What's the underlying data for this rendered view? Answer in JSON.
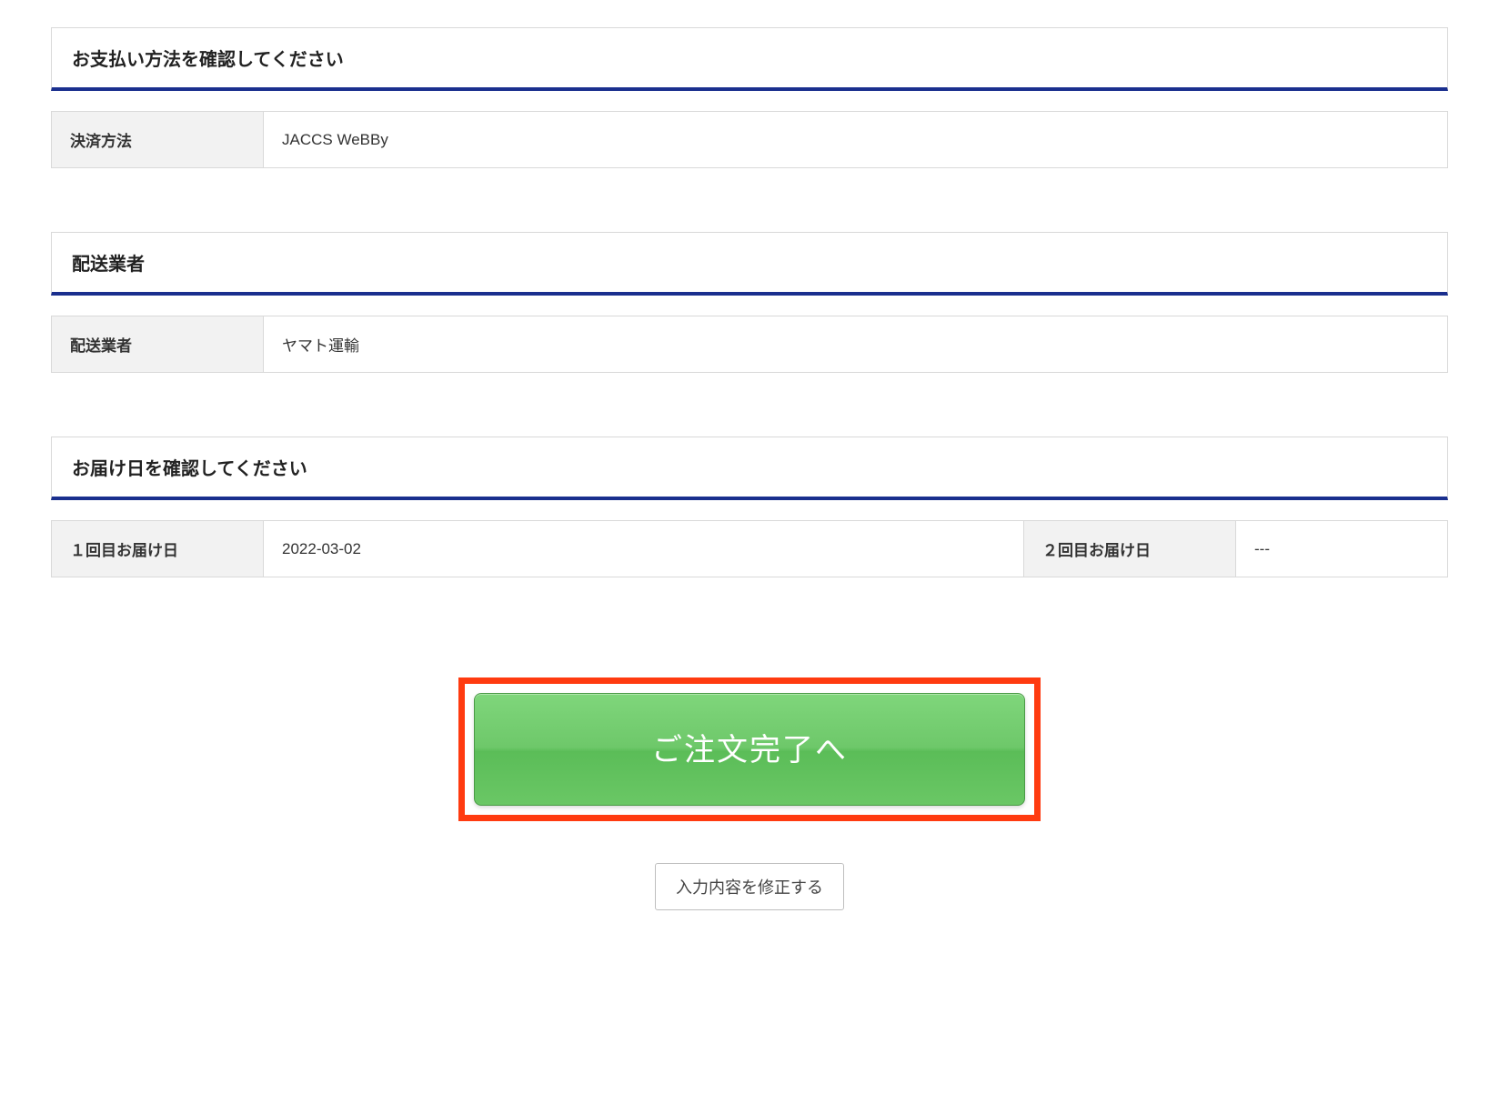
{
  "payment": {
    "header": "お支払い方法を確認してください",
    "label": "決済方法",
    "value": "JACCS WeBBy"
  },
  "carrier": {
    "header": "配送業者",
    "label": "配送業者",
    "value": "ヤマト運輸"
  },
  "delivery": {
    "header": "お届け日を確認してください",
    "first_label": "１回目お届け日",
    "first_value": "2022-03-02",
    "second_label": "２回目お届け日",
    "second_value": "---"
  },
  "buttons": {
    "primary": "ご注文完了へ",
    "secondary": "入力内容を修正する"
  }
}
